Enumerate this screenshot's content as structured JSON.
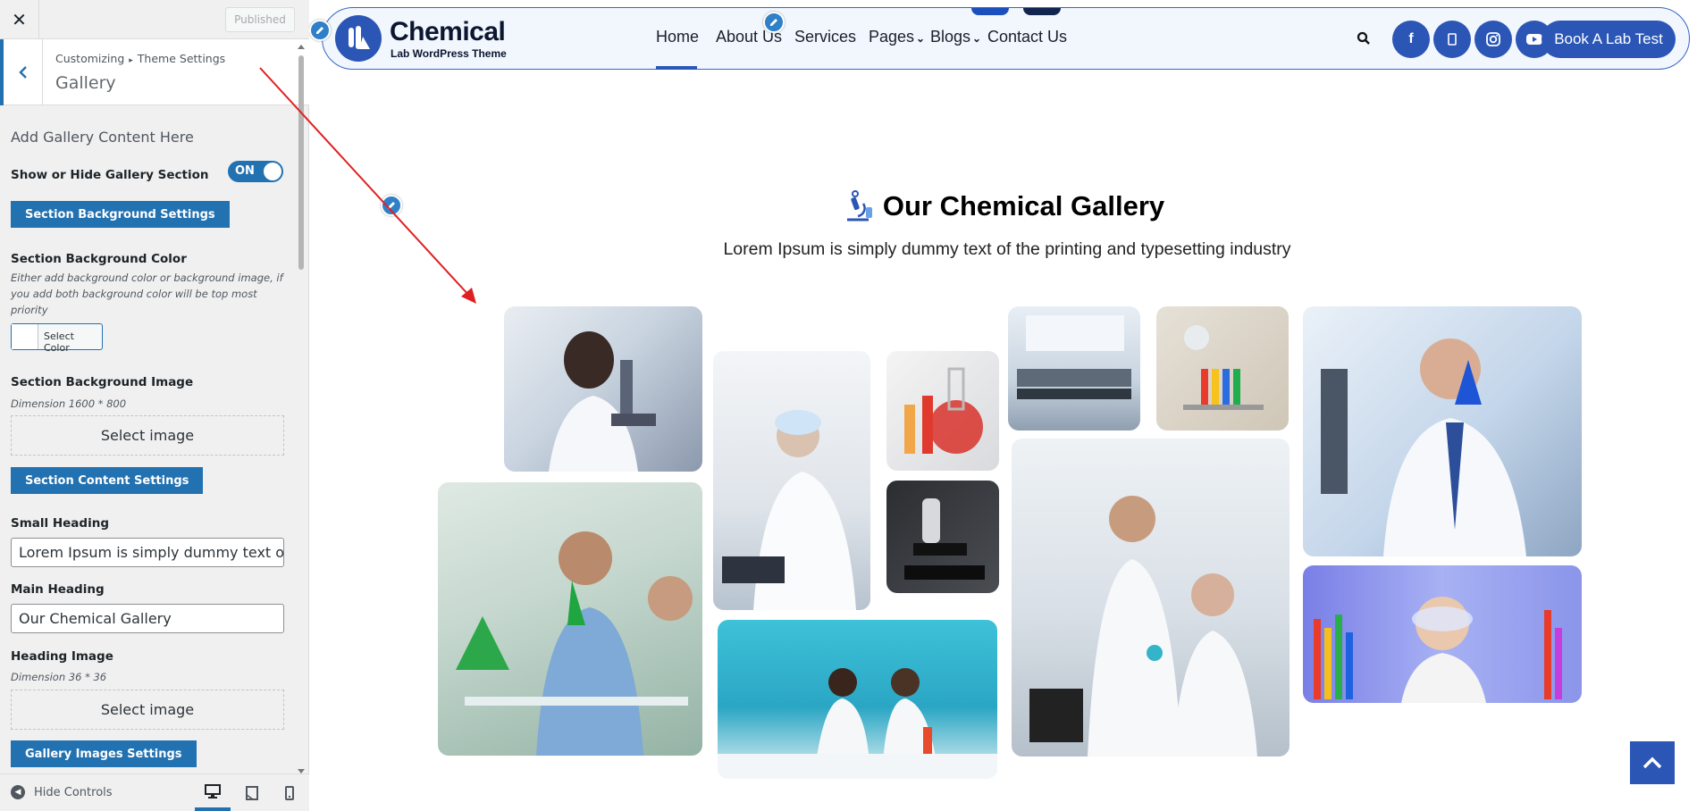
{
  "sidebar": {
    "close_icon": "close-icon",
    "published_label": "Published",
    "breadcrumb": {
      "part1": "Customizing",
      "part2": "Theme Settings"
    },
    "section_title": "Gallery",
    "intro": "Add Gallery Content Here",
    "show_hide_label": "Show or Hide Gallery Section",
    "toggle_on": "ON",
    "bg_settings_btn": "Section Background Settings",
    "bg_color_label": "Section Background Color",
    "bg_color_desc": "Either add background color or background image, if you add both background color will be top most priority",
    "select_color_label": "Select Color",
    "bg_image_label": "Section Background Image",
    "bg_image_dim": "Dimension 1600 * 800",
    "select_image_1": "Select image",
    "content_settings_btn": "Section Content Settings",
    "small_heading_label": "Small Heading",
    "small_heading_value": "Lorem Ipsum is simply dummy text of the printing and typesetting industry",
    "main_heading_label": "Main Heading",
    "main_heading_value": "Our Chemical Gallery",
    "heading_image_label": "Heading Image",
    "heading_image_dim": "Dimension 36 * 36",
    "select_image_2": "Select image",
    "gallery_images_btn": "Gallery Images Settings",
    "hide_controls": "Hide Controls"
  },
  "preview": {
    "logo_title": "Chemical",
    "logo_subtitle": "Lab WordPress Theme",
    "nav": [
      "Home",
      "About Us",
      "Services",
      "Pages",
      "Blogs",
      "Contact Us"
    ],
    "book_button": "Book A Lab Test",
    "social_icons": [
      "facebook-icon",
      "mobile-icon",
      "instagram-icon",
      "youtube-icon"
    ],
    "gallery_title": "Our Chemical Gallery",
    "gallery_subtitle": "Lorem Ipsum is simply dummy text of the printing and typesetting industry"
  },
  "colors": {
    "accent": "#2b56b6",
    "wp_blue": "#2271b1",
    "arrow_red": "#e02020"
  }
}
